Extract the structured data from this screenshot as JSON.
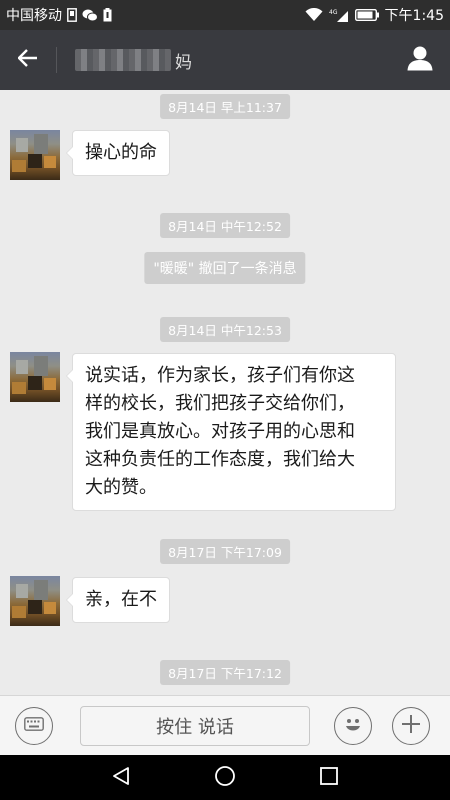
{
  "status_bar": {
    "carrier": "中国移动",
    "network_label": "4G",
    "time": "下午1:45"
  },
  "header": {
    "contact_name_visible": "妈"
  },
  "messages": [
    {
      "type": "timestamp",
      "text": "8月14日 早上11:37"
    },
    {
      "type": "received",
      "text": "操心的命"
    },
    {
      "type": "timestamp",
      "text": "8月14日 中午12:52"
    },
    {
      "type": "system",
      "text": "\"暖暖\" 撤回了一条消息"
    },
    {
      "type": "timestamp",
      "text": "8月14日 中午12:53"
    },
    {
      "type": "received",
      "lines": [
        "说实话，作为家长，孩子们有你这",
        "样的校长，我们把孩子交给你们，",
        "我们是真放心。对孩子用的心思和",
        "这种负责任的工作态度，我们给大",
        "大的赞。"
      ]
    },
    {
      "type": "timestamp",
      "text": "8月17日 下午17:09"
    },
    {
      "type": "received",
      "text": "亲，在不"
    },
    {
      "type": "timestamp",
      "text": "8月17日 下午17:12"
    }
  ],
  "input_bar": {
    "voice_label": "按住 说话"
  },
  "colors": {
    "status_bar_bg": "#2e2e2e",
    "header_bg": "#393a3f",
    "chat_bg": "#ebebeb",
    "timestamp_bg": "#cecece",
    "bubble_bg": "#ffffff"
  },
  "icons": {
    "header_left": "back-arrow-icon",
    "header_right": "person-icon",
    "input_left": "keyboard-icon",
    "input_emoji": "emoji-icon",
    "input_more": "plus-icon",
    "nav": [
      "back-triangle-icon",
      "home-circle-icon",
      "recents-square-icon"
    ]
  }
}
